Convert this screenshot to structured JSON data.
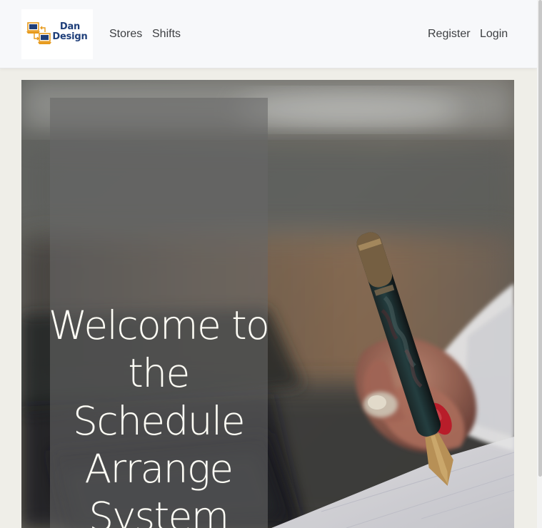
{
  "app": {
    "brand": {
      "line1": "Dan",
      "line2": "Design",
      "logo_icon": "laptop-swap-logo-icon"
    }
  },
  "navbar": {
    "left_links": [
      {
        "label": "Stores"
      },
      {
        "label": "Shifts"
      }
    ],
    "right_links": [
      {
        "label": "Register"
      },
      {
        "label": "Login"
      }
    ]
  },
  "hero": {
    "title": "Welcome to the Schedule Arrange System",
    "image_icon": "writing-hand-pen-image"
  },
  "colors": {
    "navbar_background": "#f7f8fa",
    "page_background": "#efeee8",
    "brand_blue": "#1f3f7a",
    "logo_orange": "#e79a1c",
    "hero_text": "#fffef6",
    "nav_text": "#3d3f42"
  }
}
